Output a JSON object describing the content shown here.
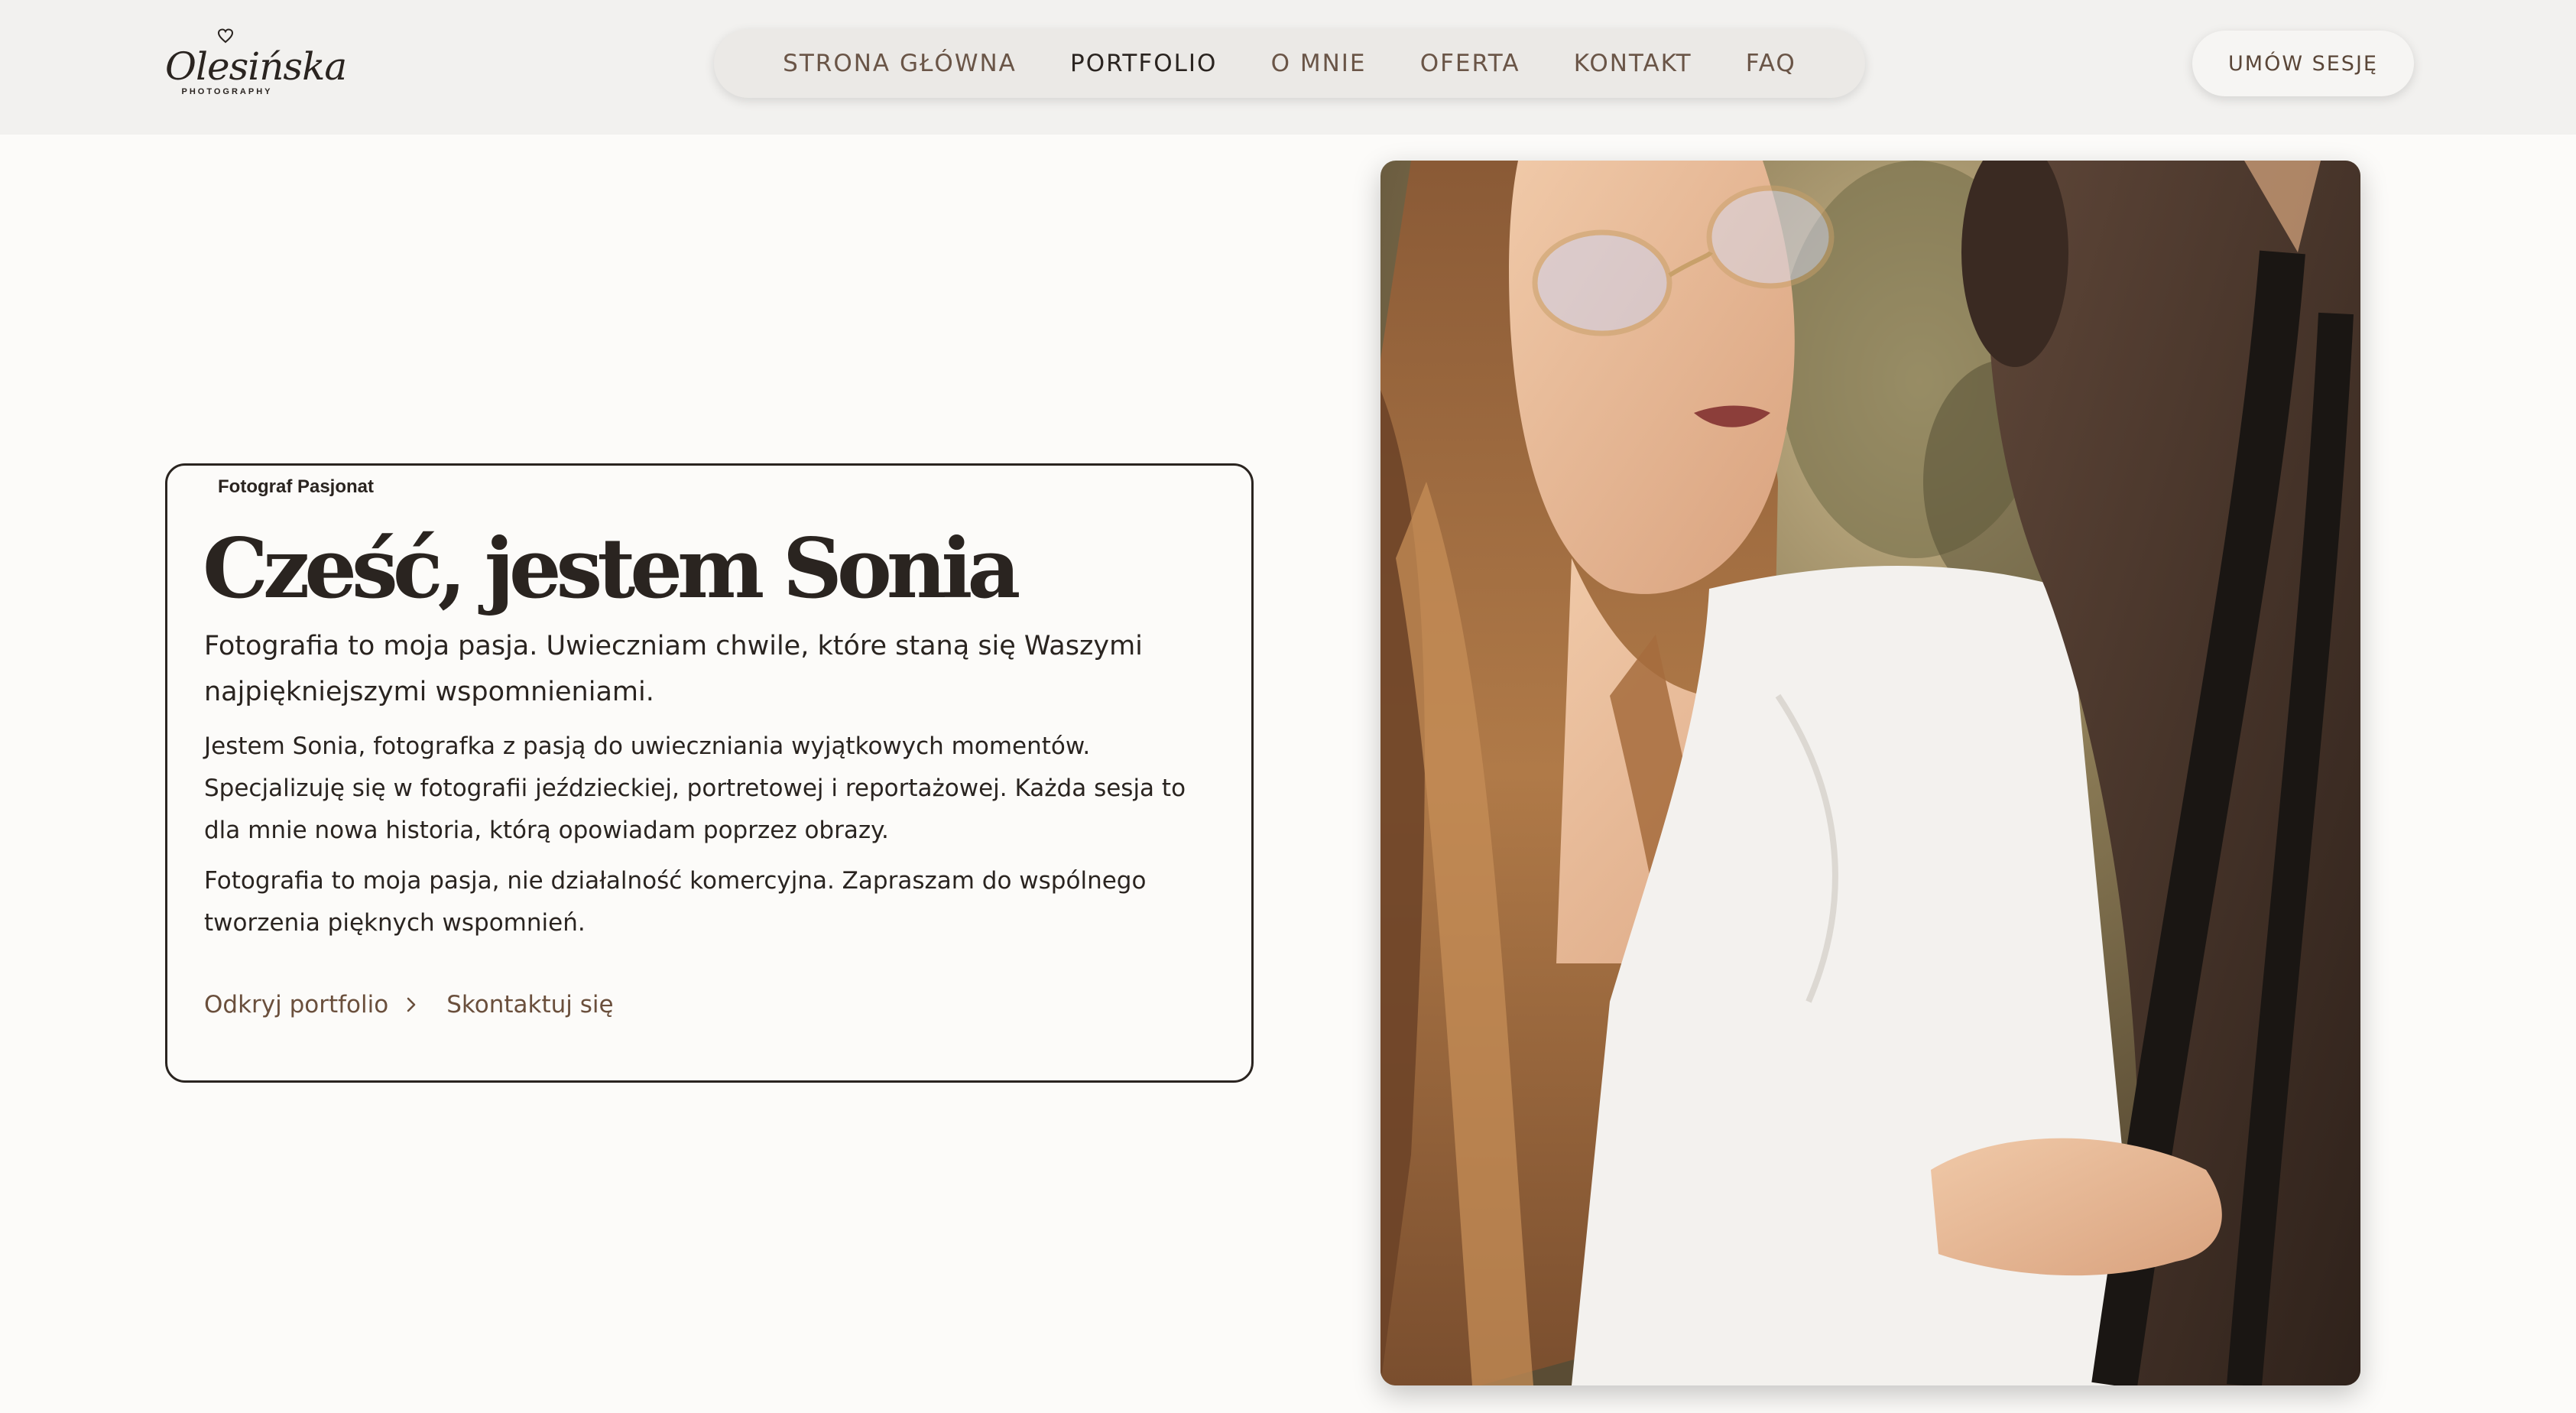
{
  "header": {
    "logo": {
      "script_text": "Olesińska",
      "sub_text": "PHOTOGRAPHY",
      "icon": "heart-icon"
    },
    "nav": [
      {
        "label": "STRONA GŁÓWNA",
        "active": false
      },
      {
        "label": "PORTFOLIO",
        "active": true
      },
      {
        "label": "O MNIE",
        "active": false
      },
      {
        "label": "OFERTA",
        "active": false
      },
      {
        "label": "KONTAKT",
        "active": false
      },
      {
        "label": "FAQ",
        "active": false
      }
    ],
    "cta_label": "UMÓW SESJĘ"
  },
  "hero": {
    "eyebrow": "Fotograf Pasjonat",
    "title": "Cześć, jestem Sonia",
    "lead": "Fotografia to moja pasja. Uwieczniam chwile, które staną się Waszymi najpiękniejszymi wspomnieniami.",
    "body_1": "Jestem Sonia, fotografka z pasją do uwieczniania wyjątkowych momentów. Specjalizuję się w fotografii jeździeckiej, portretowej i reportażowej. Każda sesja to dla mnie nowa historia, którą opowiadam poprzez obrazy.",
    "body_2": "Fotografia to moja pasja, nie działalność komercyjna. Zapraszam do wspólnego tworzenia pięknych wspomnień.",
    "link_portfolio": "Odkryj portfolio",
    "link_contact": "Skontaktuj się",
    "link_icon": "chevron-right-icon"
  },
  "colors": {
    "page_bg": "#fcfbf9",
    "header_bg": "#f2f1ef",
    "text_dark": "#2a2420",
    "accent_brown": "#6a4f3c"
  }
}
